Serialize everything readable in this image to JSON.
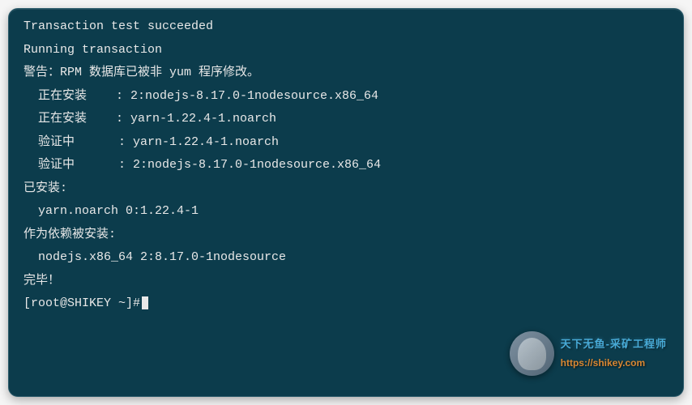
{
  "terminal": {
    "lines": [
      "Transaction test succeeded",
      "Running transaction",
      "警告：RPM 数据库已被非 yum 程序修改。",
      "  正在安装    : 2:nodejs-8.17.0-1nodesource.x86_64",
      "  正在安装    : yarn-1.22.4-1.noarch",
      "  验证中      : yarn-1.22.4-1.noarch",
      "  验证中      : 2:nodejs-8.17.0-1nodesource.x86_64",
      "",
      "已安装:",
      "  yarn.noarch 0:1.22.4-1",
      "",
      "作为依赖被安装:",
      "  nodejs.x86_64 2:8.17.0-1nodesource",
      "",
      "完毕！",
      "[root@SHIKEY ~]#"
    ]
  },
  "watermark": {
    "title": "天下无鱼-采矿工程师",
    "url": "https://shikey.com"
  }
}
